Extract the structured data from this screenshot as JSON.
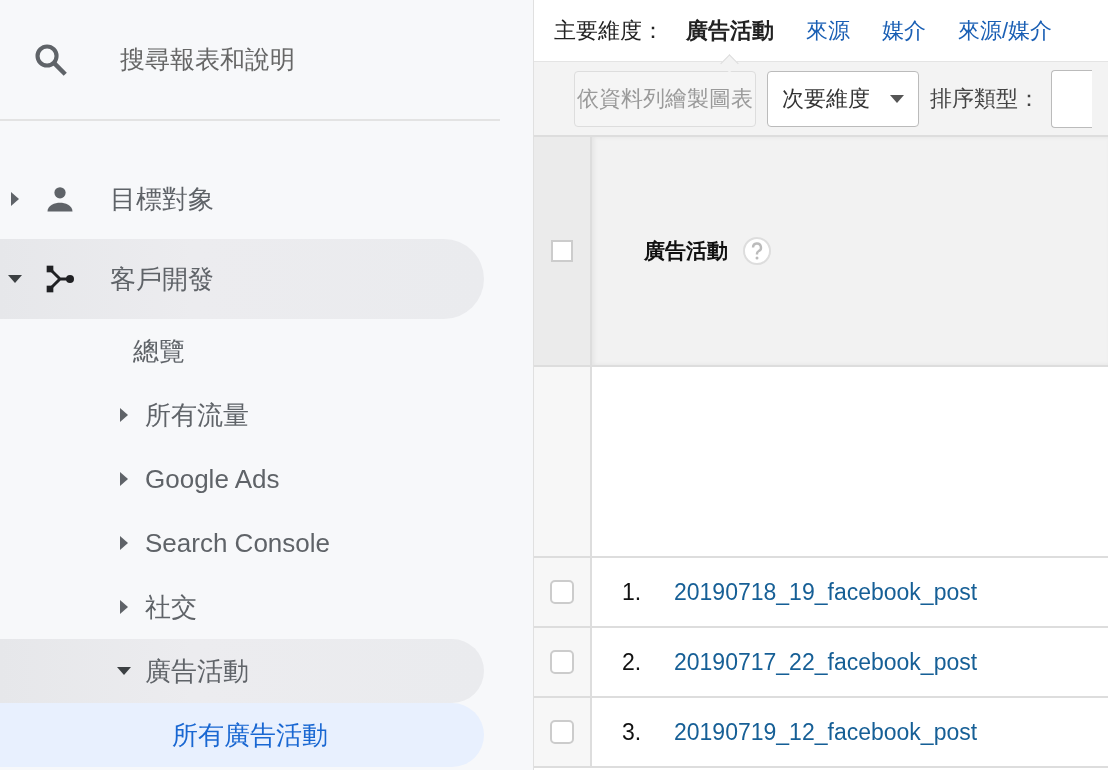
{
  "sidebar": {
    "search": {
      "placeholder": "搜尋報表和說明"
    },
    "items": [
      {
        "label": "目標對象",
        "kind": "group",
        "expanded": false,
        "selected": false
      },
      {
        "label": "客戶開發",
        "kind": "group",
        "expanded": true,
        "selected": false,
        "children": [
          {
            "label": "總覽",
            "kind": "link",
            "selected": false
          },
          {
            "label": "所有流量",
            "kind": "group",
            "expanded": false,
            "selected": false
          },
          {
            "label": "Google Ads",
            "kind": "group",
            "expanded": false,
            "selected": false
          },
          {
            "label": "Search Console",
            "kind": "group",
            "expanded": false,
            "selected": false
          },
          {
            "label": "社交",
            "kind": "group",
            "expanded": false,
            "selected": false
          },
          {
            "label": "廣告活動",
            "kind": "group",
            "expanded": true,
            "selected": false,
            "children": [
              {
                "label": "所有廣告活動",
                "kind": "link",
                "selected": true
              }
            ]
          }
        ]
      }
    ]
  },
  "report": {
    "primary_dimension": {
      "label": "主要維度：",
      "options": [
        {
          "label": "廣告活動",
          "selected": true
        },
        {
          "label": "來源",
          "selected": false
        },
        {
          "label": "媒介",
          "selected": false
        },
        {
          "label": "來源/媒介",
          "selected": false
        }
      ]
    },
    "toolbar": {
      "plot_button": {
        "label": "依資料列繪製圖表",
        "disabled": true
      },
      "secondary_dimension": {
        "label": "次要維度"
      },
      "sort_label": "排序類型："
    },
    "table": {
      "header": {
        "checked": false,
        "column": "廣告活動"
      },
      "rows": [
        {
          "index": "1.",
          "name": "20190718_19_facebook_post",
          "checked": false
        },
        {
          "index": "2.",
          "name": "20190717_22_facebook_post",
          "checked": false
        },
        {
          "index": "3.",
          "name": "20190719_12_facebook_post",
          "checked": false
        }
      ]
    }
  }
}
